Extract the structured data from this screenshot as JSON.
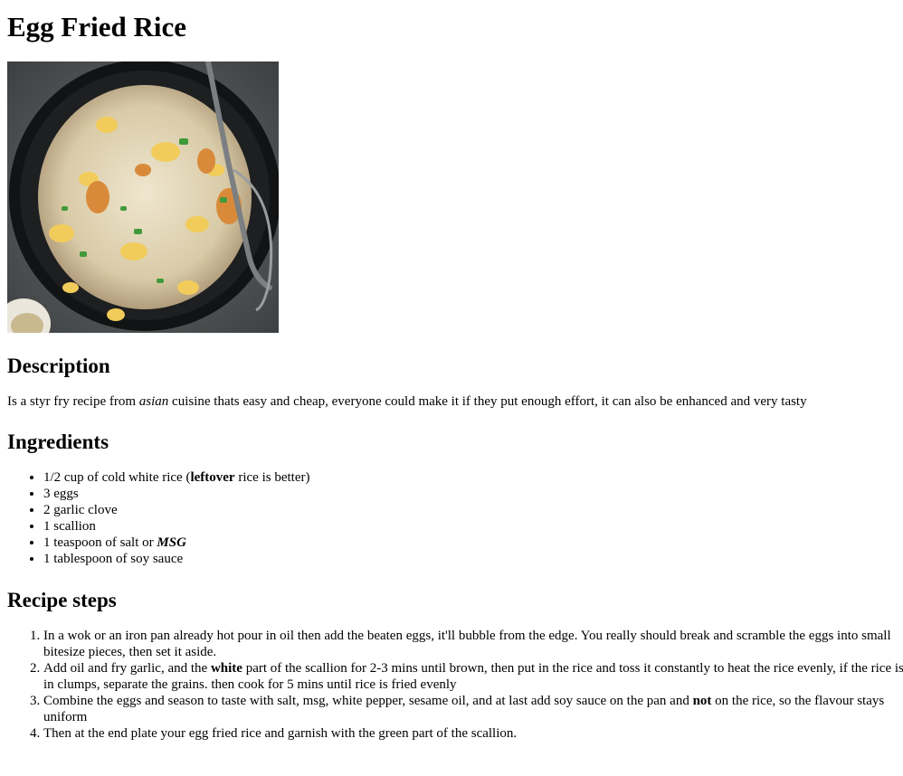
{
  "title": "Egg Fried Rice",
  "description": {
    "heading": "Description",
    "text_before": "Is a styr fry recipe from ",
    "emphasis": "asian",
    "text_after": " cuisine thats easy and cheap, everyone could make it if they put enough effort, it can also be enhanced and very tasty"
  },
  "ingredients": {
    "heading": "Ingredients",
    "item1_before": "1/2 cup of cold white rice (",
    "item1_bold": "leftover",
    "item1_after": " rice is better)",
    "item2": "3 eggs",
    "item3": "2 garlic clove",
    "item4": "1 scallion",
    "item5_before": "1 teaspoon of salt or ",
    "item5_bold_italic": "MSG",
    "item6": "1 tablespoon of soy sauce"
  },
  "steps": {
    "heading": "Recipe steps",
    "step1": "In a wok or an iron pan already hot pour in oil then add the beaten eggs, it'll bubble from the edge. You really should break and scramble the eggs into small bitesize pieces, then set it aside.",
    "step2_before": "Add oil and fry garlic, and the ",
    "step2_bold": "white",
    "step2_after": " part of the scallion for 2-3 mins until brown, then put in the rice and toss it constantly to heat the rice evenly, if the rice is in clumps, separate the grains. then cook for 5 mins until rice is fried evenly",
    "step3_before": "Combine the eggs and season to taste with salt, msg, white pepper, sesame oil, and at last add soy sauce on the pan and ",
    "step3_bold": "not",
    "step3_after": " on the rice, so the flavour stays uniform",
    "step4": "Then at the end plate your egg fried rice and garnish with the green part of the scallion."
  }
}
